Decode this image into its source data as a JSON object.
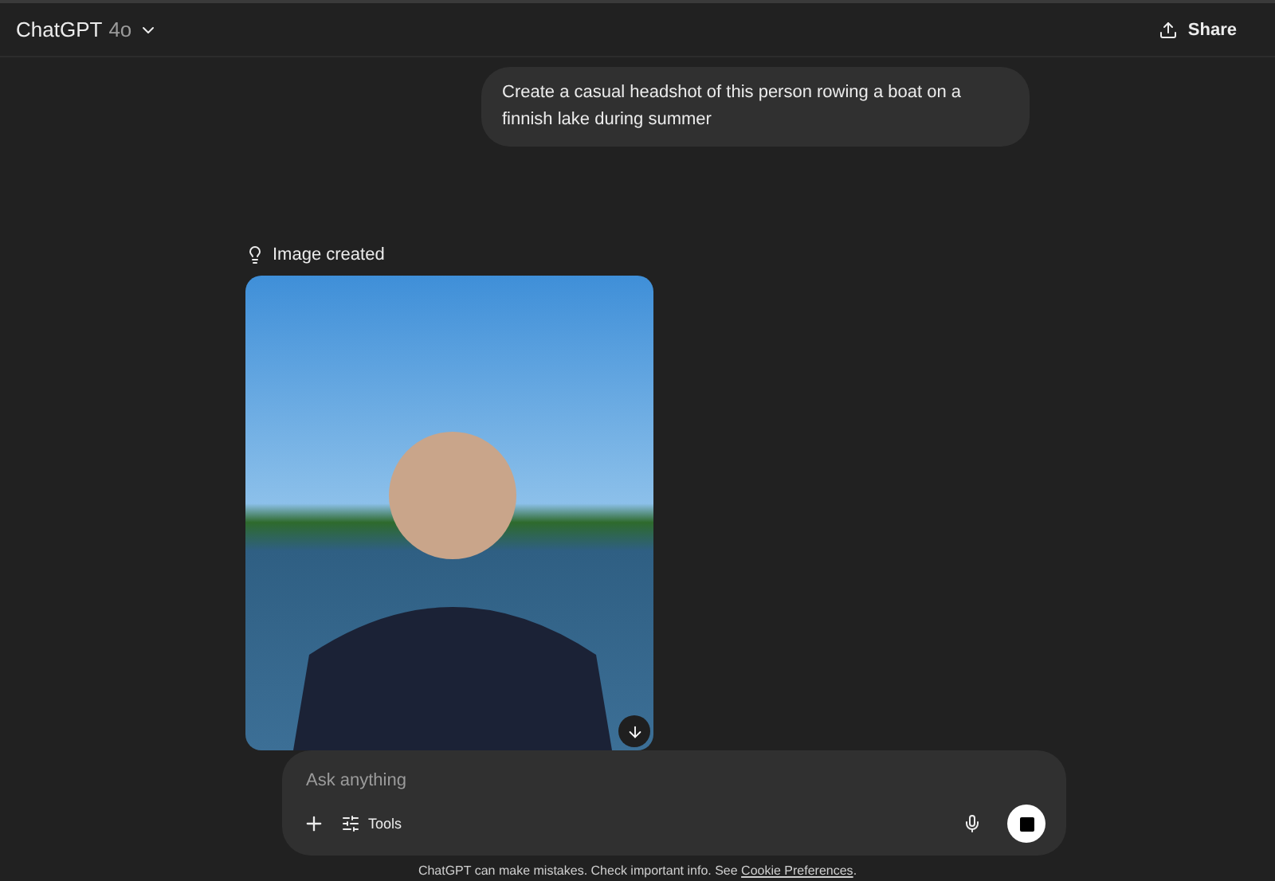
{
  "header": {
    "title": "ChatGPT",
    "model": "4o",
    "share": "Share"
  },
  "user_message": "Create a casual headshot of this person rowing a boat on a finnish lake during summer",
  "assistant": {
    "status": "Image created"
  },
  "composer": {
    "placeholder": "Ask anything",
    "tools": "Tools"
  },
  "footer": {
    "text": "ChatGPT can make mistakes. Check important info. See ",
    "link": "Cookie Preferences",
    "end": "."
  }
}
